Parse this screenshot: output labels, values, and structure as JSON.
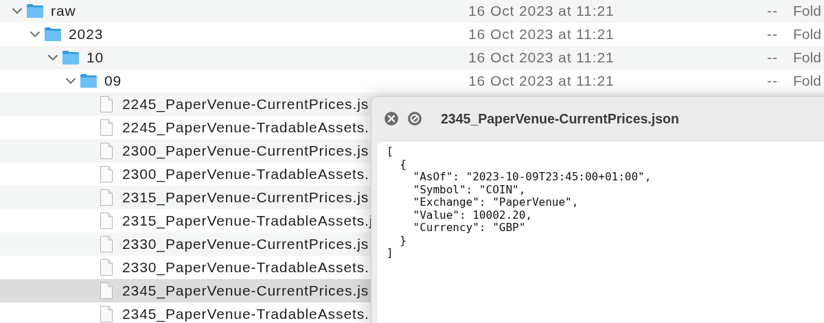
{
  "items": [
    {
      "kind": "folder",
      "name": "raw",
      "modified": "16 Oct 2023 at 11:21",
      "size": "--",
      "type": "Fold",
      "expanded": true,
      "selected": false,
      "children": [
        {
          "kind": "folder",
          "name": "2023",
          "modified": "16 Oct 2023 at 11:21",
          "size": "--",
          "type": "Fold",
          "expanded": true,
          "selected": false,
          "children": [
            {
              "kind": "folder",
              "name": "10",
              "modified": "16 Oct 2023 at 11:21",
              "size": "--",
              "type": "Fold",
              "expanded": true,
              "selected": false,
              "children": [
                {
                  "kind": "folder",
                  "name": "09",
                  "modified": "16 Oct 2023 at 11:21",
                  "size": "--",
                  "type": "Fold",
                  "expanded": true,
                  "selected": false,
                  "children": [
                    {
                      "kind": "file",
                      "name": "2245_PaperVenue-CurrentPrices.js",
                      "selected": false
                    },
                    {
                      "kind": "file",
                      "name": "2245_PaperVenue-TradableAssets.",
                      "selected": false
                    },
                    {
                      "kind": "file",
                      "name": "2300_PaperVenue-CurrentPrices.js",
                      "selected": false
                    },
                    {
                      "kind": "file",
                      "name": "2300_PaperVenue-TradableAssets.",
                      "selected": false
                    },
                    {
                      "kind": "file",
                      "name": "2315_PaperVenue-CurrentPrices.js",
                      "selected": false
                    },
                    {
                      "kind": "file",
                      "name": "2315_PaperVenue-TradableAssets.j",
                      "selected": false
                    },
                    {
                      "kind": "file",
                      "name": "2330_PaperVenue-CurrentPrices.js",
                      "selected": false
                    },
                    {
                      "kind": "file",
                      "name": "2330_PaperVenue-TradableAssets.",
                      "selected": false
                    },
                    {
                      "kind": "file",
                      "name": "2345_PaperVenue-CurrentPrices.js",
                      "selected": true
                    },
                    {
                      "kind": "file",
                      "name": "2345_PaperVenue-TradableAssets.",
                      "selected": false
                    }
                  ]
                }
              ]
            }
          ]
        }
      ]
    }
  ],
  "preview": {
    "title": "2345_PaperVenue-CurrentPrices.json",
    "lines": [
      "[",
      "  {",
      "    \"AsOf\": \"2023-10-09T23:45:00+01:00\",",
      "    \"Symbol\": \"COIN\",",
      "    \"Exchange\": \"PaperVenue\",",
      "    \"Value\": 10002.20,",
      "    \"Currency\": \"GBP\"",
      "  }",
      "]"
    ]
  }
}
